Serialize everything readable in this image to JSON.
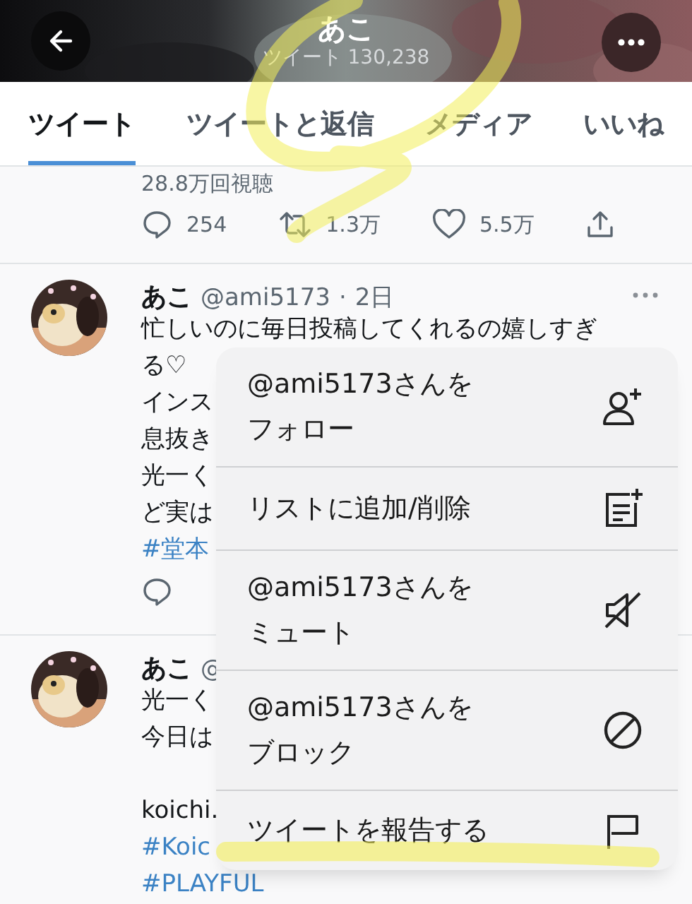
{
  "header": {
    "title": "あこ",
    "subtitle": "ツイート 130,238"
  },
  "tabs": [
    {
      "label": "ツイート",
      "selected": true
    },
    {
      "label": "ツイートと返信",
      "selected": false
    },
    {
      "label": "メディア",
      "selected": false
    },
    {
      "label": "いいね",
      "selected": false
    }
  ],
  "previous_tweet": {
    "views": "28.8万回視聴",
    "actions": [
      {
        "kind": "reply",
        "count": "254"
      },
      {
        "kind": "retweet",
        "count": "1.3万"
      },
      {
        "kind": "like",
        "count": "5.5万"
      },
      {
        "kind": "share"
      }
    ]
  },
  "tweets": [
    {
      "name": "あこ",
      "handle": "@ami5173",
      "separator": "·",
      "time": "2日",
      "more": true,
      "lines": [
        {
          "kind": "text",
          "text": "忙しいのに毎日投稿してくれるの嬉しすぎ"
        },
        {
          "kind": "text",
          "text": "る♡"
        },
        {
          "kind": "text",
          "text": "インス"
        },
        {
          "kind": "text",
          "text": "息抜き"
        },
        {
          "kind": "text",
          "text": "光一く"
        },
        {
          "kind": "text",
          "text": "ど実は"
        },
        {
          "kind": "hashtag",
          "text": "#堂本"
        }
      ],
      "actions": [
        {
          "kind": "reply"
        }
      ]
    },
    {
      "name": "あこ",
      "handle": "@",
      "more": false,
      "lines": [
        {
          "kind": "text",
          "text": "光一く"
        },
        {
          "kind": "text",
          "text": "今日は"
        },
        {
          "kind": "spacer"
        },
        {
          "kind": "text",
          "text": "koichi."
        },
        {
          "kind": "hashtag",
          "text": "#Koic"
        },
        {
          "kind": "hashtag",
          "text": "#PLAYFUL"
        }
      ]
    }
  ],
  "menu": [
    {
      "lines": [
        "@ami5173さんを",
        "フォロー"
      ],
      "kind": "follow"
    },
    {
      "lines": [
        "リストに追加/削除"
      ],
      "kind": "list"
    },
    {
      "lines": [
        "@ami5173さんを",
        "ミュート"
      ],
      "kind": "mute"
    },
    {
      "lines": [
        "@ami5173さんを",
        "ブロック"
      ],
      "kind": "block"
    },
    {
      "lines": [
        "ツイートを報告する"
      ],
      "kind": "report"
    }
  ]
}
